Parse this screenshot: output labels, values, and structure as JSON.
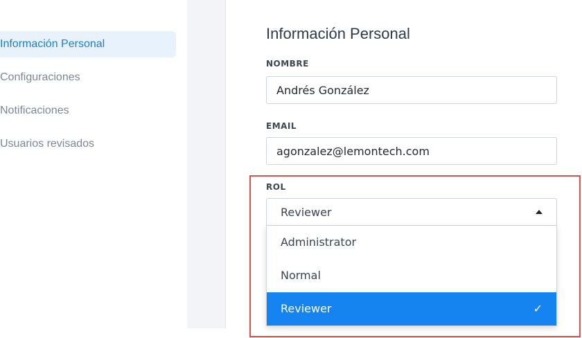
{
  "sidebar": {
    "items": [
      {
        "label": "Información Personal",
        "active": true
      },
      {
        "label": "Configuraciones",
        "active": false
      },
      {
        "label": "Notificaciones",
        "active": false
      },
      {
        "label": "Usuarios revisados",
        "active": false
      }
    ]
  },
  "main": {
    "title": "Información Personal",
    "name_label": "NOMBRE",
    "name_value": "Andrés González",
    "email_label": "EMAIL",
    "email_value": "agonzalez@lemontech.com",
    "role_label": "ROL",
    "role_selected": "Reviewer",
    "role_options": [
      {
        "label": "Administrator",
        "selected": false
      },
      {
        "label": "Normal",
        "selected": false
      },
      {
        "label": "Reviewer",
        "selected": true
      }
    ],
    "check_mark": "✓"
  },
  "colors": {
    "accent": "#1583f0",
    "active_nav_bg": "#e8f2fd",
    "active_nav_text": "#1a7fd4",
    "highlight_border": "#e0504a"
  }
}
